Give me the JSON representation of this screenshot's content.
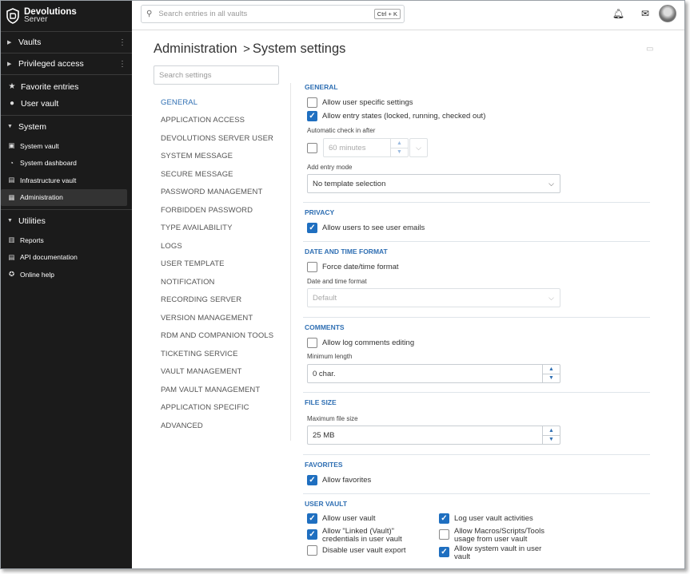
{
  "brand": {
    "name": "Devolutions",
    "product": "Server"
  },
  "sidebar": {
    "vaults": "Vaults",
    "privileged_access": "Privileged access",
    "favorite_entries": "Favorite entries",
    "user_vault": "User vault",
    "system": {
      "label": "System",
      "items": [
        "System vault",
        "System dashboard",
        "Infrastructure vault",
        "Administration"
      ]
    },
    "utilities": {
      "label": "Utilities",
      "items": [
        "Reports",
        "API documentation",
        "Online help"
      ]
    }
  },
  "topbar": {
    "search_placeholder": "Search entries in all vaults",
    "shortcut": "Ctrl + K"
  },
  "page": {
    "breadcrumb_root": "Administration",
    "breadcrumb_sep": ">",
    "title": "System settings"
  },
  "settings_search_placeholder": "Search settings",
  "nav": [
    "GENERAL",
    "APPLICATION ACCESS",
    "DEVOLUTIONS SERVER USER",
    "SYSTEM MESSAGE",
    "SECURE MESSAGE",
    "PASSWORD MANAGEMENT",
    "FORBIDDEN PASSWORD",
    "TYPE AVAILABILITY",
    "LOGS",
    "USER TEMPLATE",
    "NOTIFICATION",
    "RECORDING SERVER",
    "VERSION MANAGEMENT",
    "RDM AND COMPANION TOOLS",
    "TICKETING SERVICE",
    "VAULT MANAGEMENT",
    "PAM VAULT MANAGEMENT",
    "APPLICATION SPECIFIC",
    "ADVANCED"
  ],
  "general": {
    "title": "GENERAL",
    "allow_user_specific": {
      "label": "Allow user specific settings",
      "checked": false
    },
    "allow_entry_states": {
      "label": "Allow entry states (locked, running, checked out)",
      "checked": true
    },
    "auto_checkin_label": "Automatic check in after",
    "auto_checkin_checked": false,
    "auto_checkin_value": "60 minutes",
    "add_entry_mode_label": "Add entry mode",
    "add_entry_mode_value": "No template selection"
  },
  "privacy": {
    "title": "PRIVACY",
    "allow_emails": {
      "label": "Allow users to see user emails",
      "checked": true
    }
  },
  "datetime": {
    "title": "DATE AND TIME FORMAT",
    "force": {
      "label": "Force date/time format",
      "checked": false
    },
    "format_label": "Date and time format",
    "format_value": "Default"
  },
  "comments": {
    "title": "COMMENTS",
    "allow_editing": {
      "label": "Allow log comments editing",
      "checked": false
    },
    "min_length_label": "Minimum length",
    "min_length_value": "0 char."
  },
  "file_size": {
    "title": "FILE SIZE",
    "max_label": "Maximum file size",
    "max_value": "25 MB"
  },
  "favorites": {
    "title": "FAVORITES",
    "allow": {
      "label": "Allow favorites",
      "checked": true
    }
  },
  "user_vault": {
    "title": "USER VAULT",
    "allow_user_vault": {
      "label": "Allow user vault",
      "checked": true
    },
    "allow_linked": {
      "label": "Allow \"Linked (Vault)\" credentials in user vault",
      "checked": true
    },
    "disable_export": {
      "label": "Disable user vault export",
      "checked": false
    },
    "log_activities": {
      "label": "Log user vault activities",
      "checked": true
    },
    "allow_macros": {
      "label": "Allow Macros/Scripts/Tools usage from user vault",
      "checked": false
    },
    "allow_system_vault": {
      "label": "Allow system vault in user vault",
      "checked": true
    }
  },
  "colors": {
    "sidebar_bg": "#1b1b1b",
    "accent": "#2f6fb3",
    "checkbox_checked": "#1f6fc0"
  }
}
